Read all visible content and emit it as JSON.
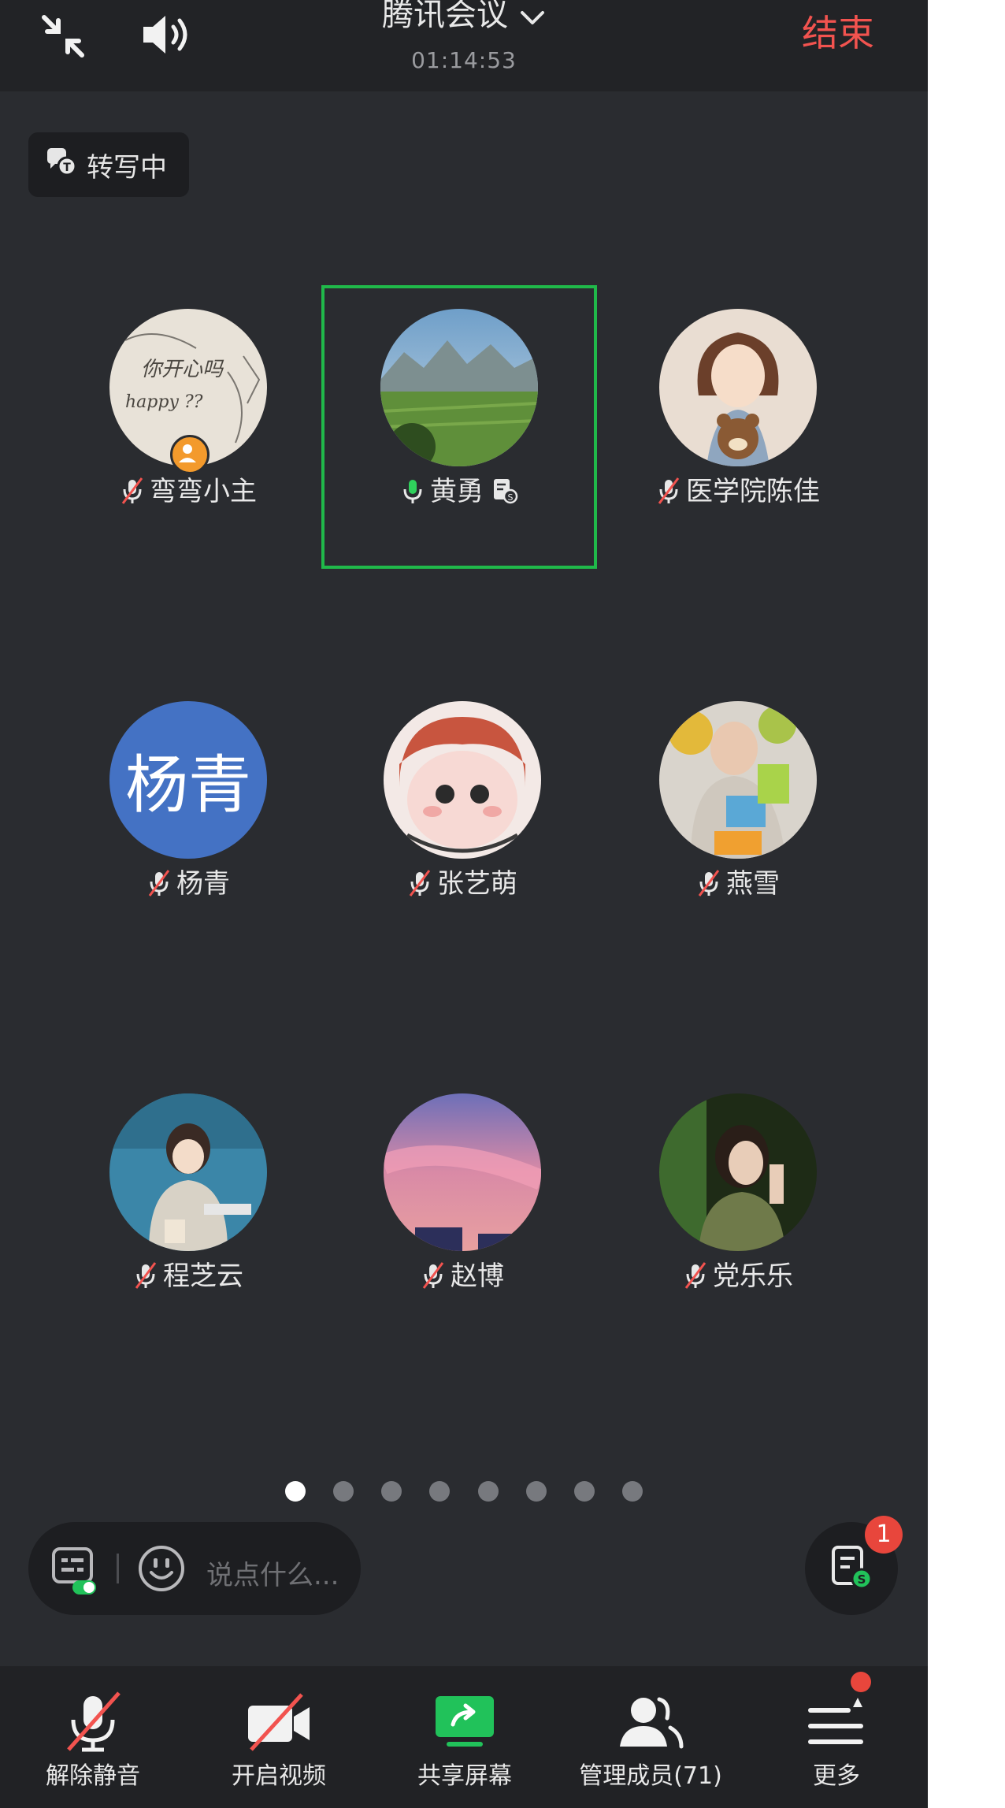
{
  "header": {
    "title": "腾讯会议",
    "timer": "01:14:53",
    "end_label": "结束"
  },
  "transcribe": {
    "label": "转写中"
  },
  "participants": [
    {
      "name": "弯弯小主",
      "mic": "muted",
      "host": true
    },
    {
      "name": "黄勇",
      "mic": "speaking",
      "active": true
    },
    {
      "name": "医学院陈佳",
      "mic": "muted"
    },
    {
      "name": "杨青",
      "mic": "muted",
      "avatar_text": "杨青"
    },
    {
      "name": "张艺萌",
      "mic": "muted"
    },
    {
      "name": "燕雪",
      "mic": "muted"
    },
    {
      "name": "程芝云",
      "mic": "muted"
    },
    {
      "name": "赵博",
      "mic": "muted"
    },
    {
      "name": "党乐乐",
      "mic": "muted"
    }
  ],
  "pager": {
    "pages": 8,
    "current": 1
  },
  "chat": {
    "placeholder": "说点什么..."
  },
  "notes": {
    "badge": "1"
  },
  "toolbar": {
    "unmute": "解除静音",
    "video": "开启视频",
    "share": "共享屏幕",
    "members": "管理成员(71)",
    "more": "更多"
  },
  "colors": {
    "background": "#2a2c30",
    "end_red": "#f2534f",
    "active_green": "#20b94a",
    "text_avatar_blue": "#4472c4",
    "badge_red": "#e8463c"
  }
}
